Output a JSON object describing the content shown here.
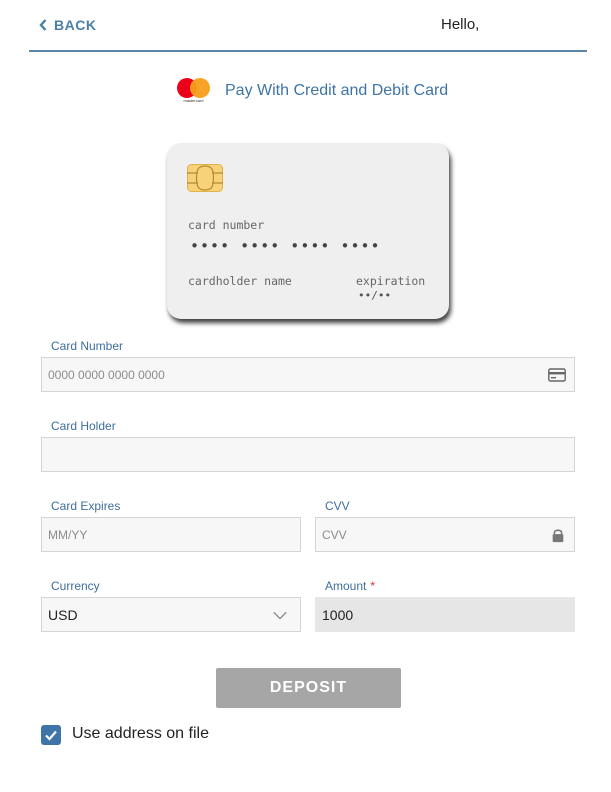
{
  "header": {
    "back_label": "BACK",
    "greeting": "Hello,"
  },
  "pay": {
    "logo_text": "mastercard",
    "title": "Pay With Credit and Debit Card"
  },
  "card_preview": {
    "number_label": "card number",
    "number_mask": "•••• •••• •••• ••••",
    "holder_label": "cardholder name",
    "expiration_label": "expiration",
    "expiration_mask": "••/••"
  },
  "form": {
    "card_number": {
      "label": "Card Number",
      "value": "",
      "placeholder": "0000 0000 0000 0000"
    },
    "card_holder": {
      "label": "Card Holder",
      "value": "",
      "placeholder": ""
    },
    "card_expires": {
      "label": "Card Expires",
      "value": "",
      "placeholder": "MM/YY"
    },
    "cvv": {
      "label": "CVV",
      "value": "",
      "placeholder": "CVV"
    },
    "currency": {
      "label": "Currency",
      "value": "USD"
    },
    "amount": {
      "label": "Amount",
      "required_mark": "*",
      "value": "1000"
    }
  },
  "deposit_label": "DEPOSIT",
  "use_address": {
    "label": "Use address on file",
    "checked": true
  },
  "colors": {
    "accent": "#3f74a8",
    "header_rule": "#5a87a8",
    "deposit_disabled": "#a6a6a6"
  }
}
